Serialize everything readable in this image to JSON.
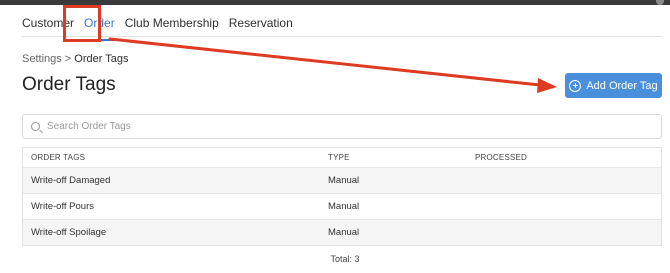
{
  "tabs": [
    {
      "label": "Customer",
      "active": false
    },
    {
      "label": "Order",
      "active": true
    },
    {
      "label": "Club Membership",
      "active": false
    },
    {
      "label": "Reservation",
      "active": false
    }
  ],
  "breadcrumb": {
    "parent": "Settings",
    "separator": " > ",
    "current": "Order Tags"
  },
  "page_title": "Order Tags",
  "add_button": {
    "label": "Add Order Tag",
    "icon": "plus-circle-icon",
    "color": "#4a8fdb"
  },
  "search": {
    "placeholder": "Search Order Tags",
    "value": ""
  },
  "table": {
    "columns": [
      "ORDER TAGS",
      "TYPE",
      "PROCESSED"
    ],
    "rows": [
      {
        "tag": "Write-off Damaged",
        "type": "Manual",
        "processed": ""
      },
      {
        "tag": "Write-off Pours",
        "type": "Manual",
        "processed": ""
      },
      {
        "tag": "Write-off Spoilage",
        "type": "Manual",
        "processed": ""
      }
    ]
  },
  "total_text": "Total: 3",
  "annotation_color": "#dd3b22",
  "accent_color": "#3b78c9"
}
